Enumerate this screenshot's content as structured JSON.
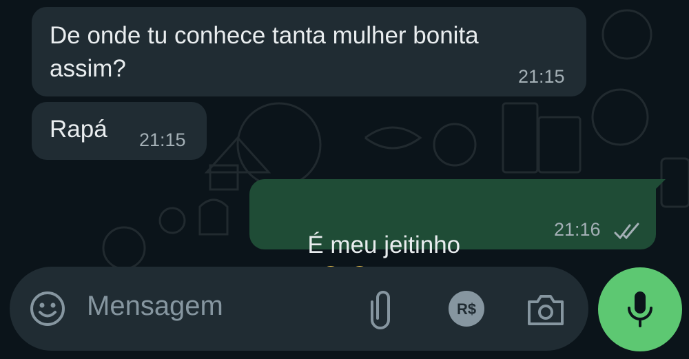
{
  "messages": [
    {
      "direction": "incoming",
      "text": "De onde tu conhece tanta mulher bonita\nassim?",
      "time": "21:15"
    },
    {
      "direction": "incoming",
      "text": "Rapá",
      "time": "21:15"
    },
    {
      "direction": "outgoing",
      "text": "É meu jeitinho",
      "emojis": [
        "relieved-face-icon",
        "relieved-face-icon"
      ],
      "time": "21:16",
      "status": "read"
    }
  ],
  "composer": {
    "placeholder": "Mensagem",
    "icons": [
      "emoji-icon",
      "paperclip-icon",
      "rupee-payment-icon",
      "camera-icon"
    ],
    "send_icon": "microphone-icon"
  },
  "colors": {
    "background": "#0b141a",
    "incoming_bubble": "#202c33",
    "outgoing_bubble": "#1f4c36",
    "accent": "#5dc872",
    "read_ticks": "#a4b0b6"
  }
}
